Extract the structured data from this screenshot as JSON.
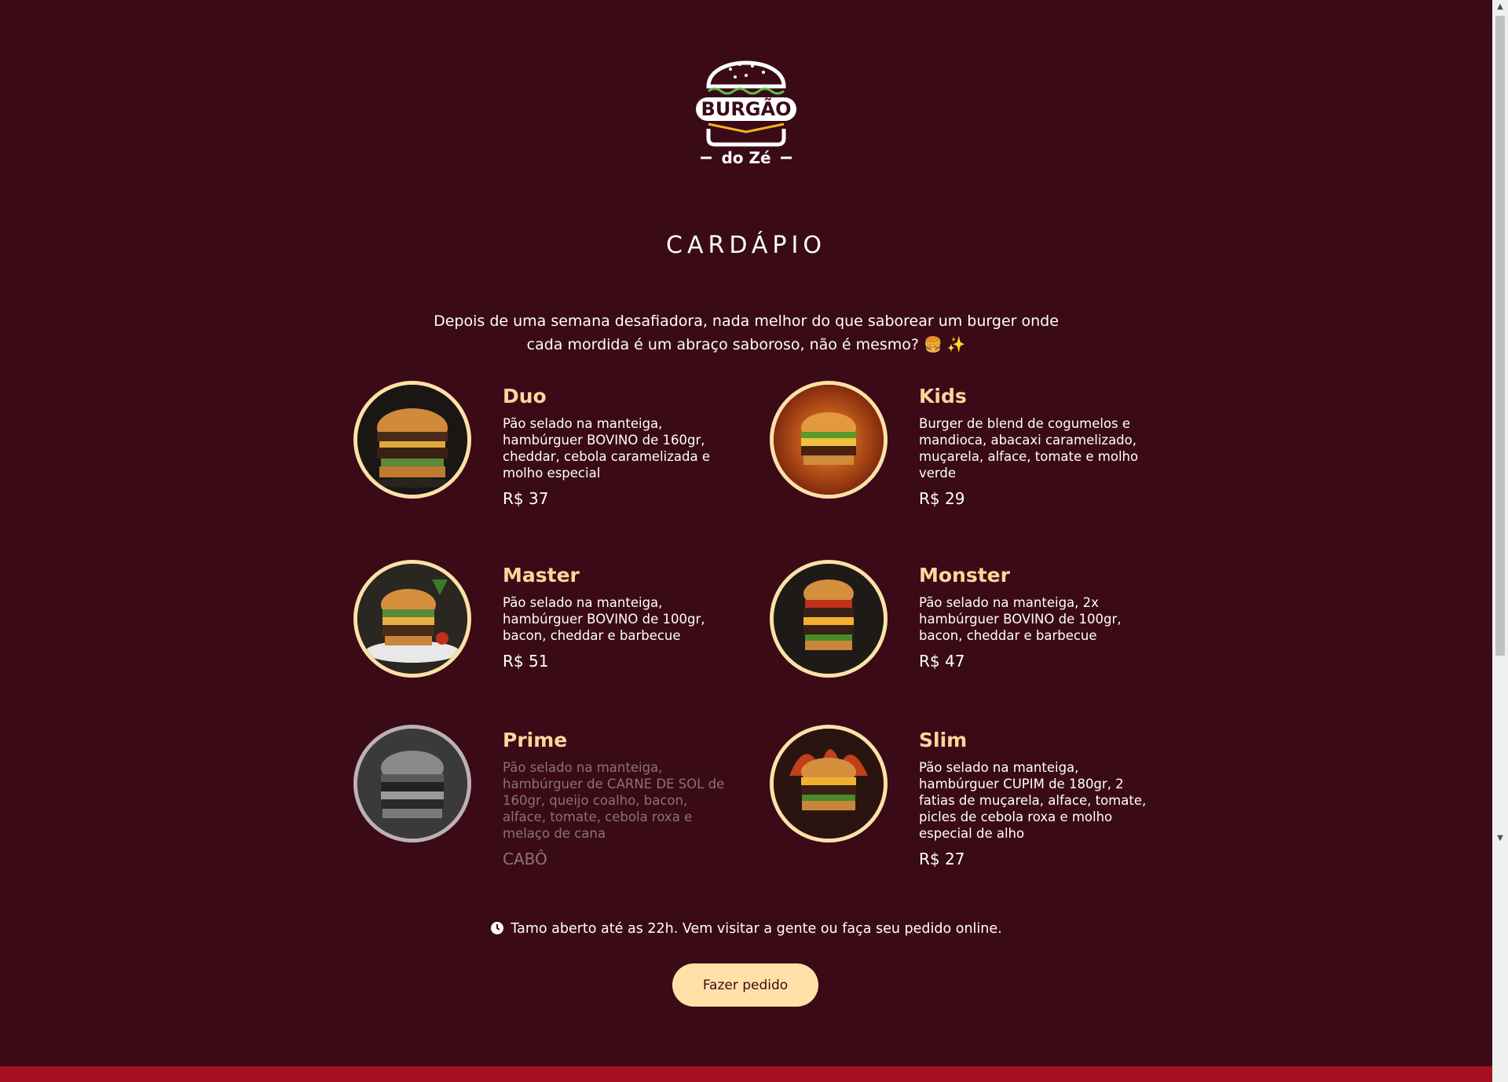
{
  "brand": {
    "logo_text_main": "BURGÃO",
    "logo_text_sub": "do Zé"
  },
  "title": "CARDÁPIO",
  "intro": "Depois de uma semana desafiadora, nada melhor do que saborear um burger onde cada mordida é um abraço saboroso, não é mesmo? 🍔 ✨",
  "menu": [
    {
      "name": "Duo",
      "description": "Pão selado na manteiga, hambúrguer BOVINO de 160gr, cheddar, cebola caramelizada e molho especial",
      "price": "R$ 37",
      "image_icon": "burger-photo",
      "sold_out": false
    },
    {
      "name": "Kids",
      "description": "Burger de blend de cogumelos e mandioca, abacaxi caramelizado, muçarela, alface, tomate e molho verde",
      "price": "R$ 29",
      "image_icon": "burger-photo",
      "sold_out": false
    },
    {
      "name": "Master",
      "description": "Pão selado na manteiga, hambúrguer BOVINO de 100gr, bacon, cheddar e barbecue",
      "price": "R$ 51",
      "image_icon": "burger-photo",
      "sold_out": false
    },
    {
      "name": "Monster",
      "description": "Pão selado na manteiga, 2x hambúrguer BOVINO de 100gr, bacon, cheddar e barbecue",
      "price": "R$ 47",
      "image_icon": "burger-photo",
      "sold_out": false
    },
    {
      "name": "Prime",
      "description": "Pão selado na manteiga, hambúrguer de CARNE DE SOL de 160gr, queijo coalho, bacon, alface, tomate, cebola roxa e melaço de cana",
      "price": "CABÔ",
      "image_icon": "burger-photo-grayscale",
      "sold_out": true
    },
    {
      "name": "Slim",
      "description": "Pão selado na manteiga, hambúrguer CUPIM de 180gr, 2 fatias de muçarela, alface, tomate, picles de cebola roxa e molho especial de alho",
      "price": "R$ 27",
      "image_icon": "burger-photo",
      "sold_out": false
    }
  ],
  "hours": "Tamo aberto até as 22h. Vem visitar a gente ou faça seu pedido online.",
  "order_button": "Fazer pedido",
  "colors": {
    "background": "#3a0a17",
    "accent": "#ffe1a7",
    "item_name": "#ffd69a",
    "footer_bar": "#a50f23"
  }
}
